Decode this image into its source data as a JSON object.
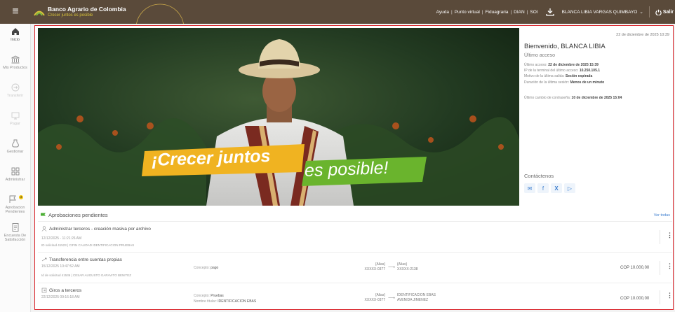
{
  "header": {
    "bank_name": "Banco Agrario de Colombia",
    "tagline": "Crecer juntos es posible",
    "links": [
      "Ayuda",
      "Punto virtual",
      "Fiduagraria",
      "DIAN",
      "SOI"
    ],
    "user_name": "BLANCA LIBIA VARGAS QUIMBAYO",
    "logout_label": "Salir"
  },
  "sidebar": {
    "items": [
      {
        "label": "Inicio",
        "icon": "home-icon",
        "state": "active"
      },
      {
        "label": "Mis Productos",
        "icon": "bank-icon",
        "state": "normal"
      },
      {
        "label": "Transferir",
        "icon": "transfer-icon",
        "state": "disabled"
      },
      {
        "label": "Pagar",
        "icon": "pay-icon",
        "state": "disabled"
      },
      {
        "label": "Gestionar",
        "icon": "manage-icon",
        "state": "normal"
      },
      {
        "label": "Administrar",
        "icon": "grid-icon",
        "state": "normal"
      },
      {
        "label": "Aprobacion Pendientes",
        "icon": "flag-icon",
        "state": "normal",
        "badge": "3"
      },
      {
        "label": "Encuesta De Satisfacción",
        "icon": "survey-icon",
        "state": "normal"
      }
    ]
  },
  "hero": {
    "line1": "¡Crecer juntos",
    "line2": "es posible!"
  },
  "panel": {
    "datetime": "22 de diciembre de 2025 10:39",
    "welcome": "Bienvenido, BLANCA LIBIA",
    "last_access_title": "Último acceso",
    "info": [
      {
        "label": "Último acceso:",
        "value": "22 de diciembre de 2025 15:39"
      },
      {
        "label": "IP de la terminal del último acceso:",
        "value": "10.250.105.1"
      },
      {
        "label": "Motivo de la última salida:",
        "value": "Sesión expirada"
      },
      {
        "label": "Duración de la última sesión:",
        "value": "Menos de un minuto"
      }
    ],
    "pwd_label": "Último cambio de contraseña:",
    "pwd_value": "10 de diciembre de 2025 15:04",
    "contact_title": "Contáctenos",
    "social": [
      "mail-icon",
      "facebook-icon",
      "x-icon",
      "youtube-icon"
    ],
    "accent": "#3e7fcf"
  },
  "pending": {
    "title": "Aprobaciones pendientes",
    "see_all": "Ver todas",
    "rows": [
      {
        "icon": "user-icon",
        "title": "Administrar terceros - creación masiva por archivo",
        "date": "12/12/2025 - 11:21:26 AM",
        "ref": "ID solicitud 41523 | CIFIN CALIDAD IDENTIFICACION PRUEBAS"
      },
      {
        "icon": "transfer-icon",
        "title": "Transferencia entre cuentas propias",
        "date": "15/12/2025 10:47:52 AM",
        "ref": "Id de solicitud 41536 | CESAR AUGUSTO GARAVITO BENITEZ",
        "concept_label": "Concepto:",
        "concept_value": "pago",
        "from_alias": "{Alias}",
        "from_acct": "XXXXX-0377",
        "to_alias": "{Alias}",
        "to_acct": "XXXXX-2138",
        "amount": "COP 10.000,00"
      },
      {
        "icon": "transfer-icon",
        "title": "Giros a terceros",
        "date": "22/12/2025 09:16:18 AM",
        "concept_label": "Concepto:",
        "concept_value": "Pruebas",
        "beneficiary_label": "Nombre titular:",
        "beneficiary_value": "IDENTIFICACION EBAS",
        "from_alias": "{Alias}",
        "from_acct": "XXXXX-0377",
        "to_alias": "IDENTIFICACION EBAS",
        "to_acct": "AVENIDA JIMENEZ",
        "amount": "COP 10.000,00"
      }
    ]
  },
  "colors": {
    "topbar": "#5a4a3a",
    "frame": "#d9262c",
    "promo_yellow": "#f0b321",
    "promo_green": "#6ab42d"
  }
}
